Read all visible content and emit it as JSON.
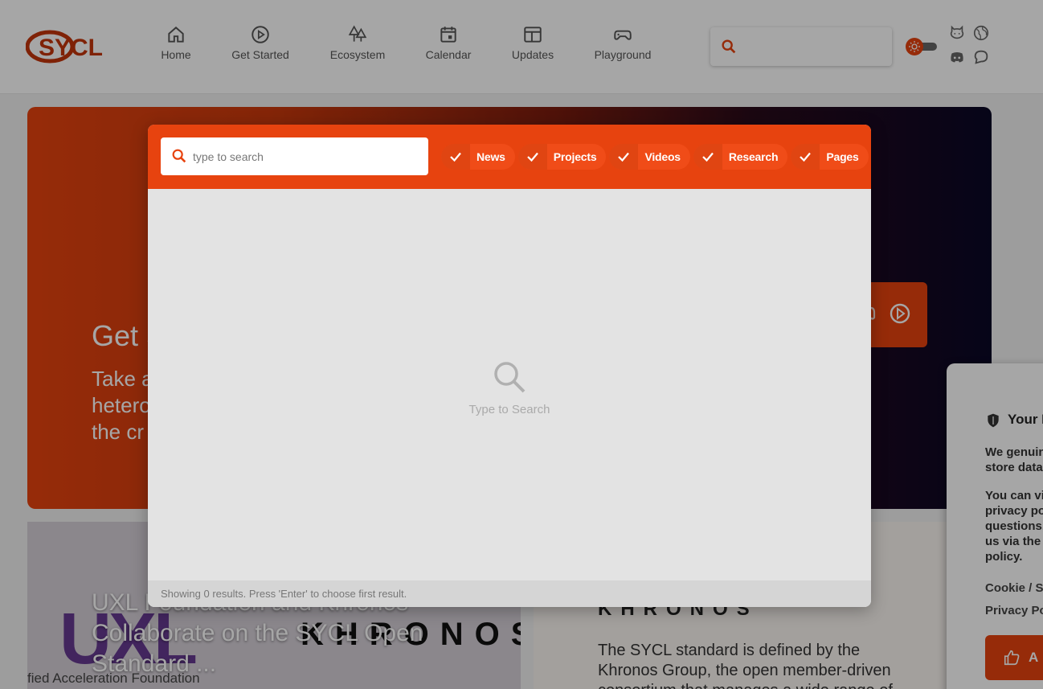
{
  "header": {
    "logo_text": "SYCL",
    "nav": [
      {
        "label": "Home",
        "icon": "home-icon"
      },
      {
        "label": "Get Started",
        "icon": "play-circle-icon"
      },
      {
        "label": "Ecosystem",
        "icon": "trees-icon"
      },
      {
        "label": "Calendar",
        "icon": "calendar-icon"
      },
      {
        "label": "Updates",
        "icon": "news-icon"
      },
      {
        "label": "Playground",
        "icon": "gamepad-icon"
      }
    ],
    "social_icons": [
      "github-icon",
      "globe-icon",
      "discord-icon",
      "chat-icon"
    ],
    "theme_toggle": "sun-icon"
  },
  "hero": {
    "title": "Get S",
    "subtitle": "Take a\nheterog\nthe cr"
  },
  "cards": {
    "left_title": "UXL Foundation and Khronos Collaborate on the SYCL Open Standard ...",
    "left_logo_text": "UXL",
    "left_logo_foot": "fied Acceleration Foundation",
    "left_partner": "KHRONOS",
    "right_logo": "KHRONOS",
    "right_text": "The SYCL standard is defined by the Khronos Group, the open member-driven consortium that manages a wide range of"
  },
  "cookie": {
    "title": "Your P",
    "p1": "We genuin\nstore data",
    "p2": "You can vi\nprivacy po\nquestions,\nus via the\npolicy.",
    "link1": "Cookie / S",
    "link2": "Privacy Po",
    "accept": "A"
  },
  "search_modal": {
    "placeholder": "type to search",
    "filters": [
      "News",
      "Projects",
      "Videos",
      "Research",
      "Pages"
    ],
    "empty_text": "Type to Search",
    "footer": "Showing 0 results. Press 'Enter' to choose first result."
  },
  "colors": {
    "accent": "#e7430f",
    "hero_dark": "#0a0826"
  }
}
